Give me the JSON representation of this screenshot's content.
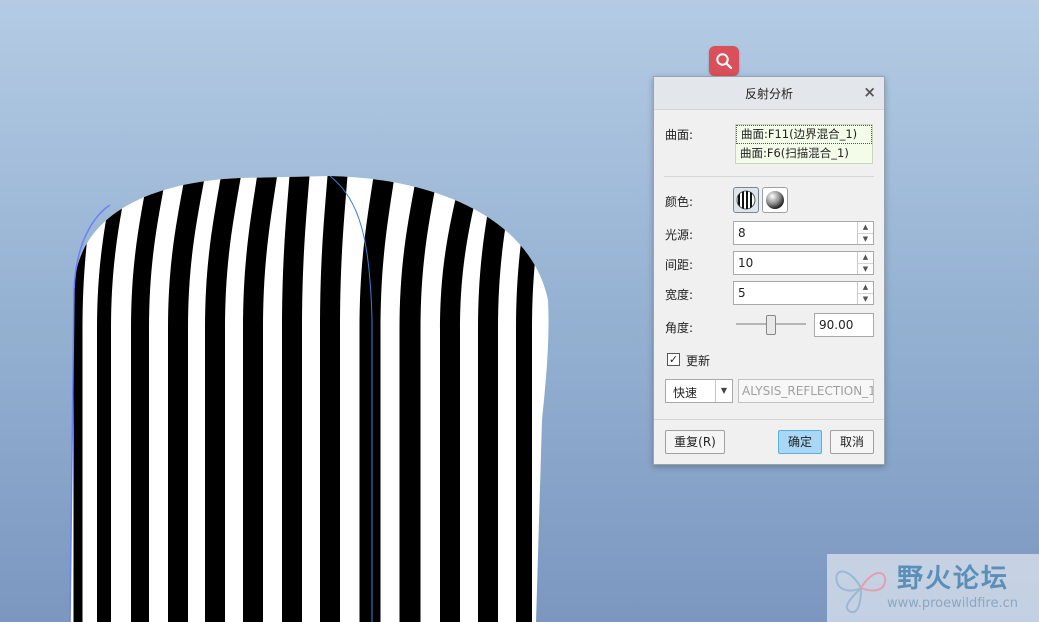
{
  "dialog": {
    "title": "反射分析",
    "surface_label": "曲面:",
    "surfaces": [
      "曲面:F11(边界混合_1)",
      "曲面:F6(扫描混合_1)"
    ],
    "color_label": "颜色:",
    "light_label": "光源:",
    "light_value": "8",
    "spacing_label": "间距:",
    "spacing_value": "10",
    "width_label": "宽度:",
    "width_value": "5",
    "angle_label": "角度:",
    "angle_value": "90.00",
    "update_label": "更新",
    "update_checked": "✓",
    "mode_value": "快速",
    "analysis_name": "ALYSIS_REFLECTION_1",
    "repeat_label": "重复(R)",
    "ok_label": "确定",
    "cancel_label": "取消"
  },
  "icons": {
    "search": "magnifier-icon",
    "close": "close-icon",
    "stripe_color": "zebra-stripes-icon",
    "shaded_color": "shaded-sphere-icon"
  },
  "watermark": {
    "title": "野火论坛",
    "url": "www.proewildfire.cn"
  },
  "colors": {
    "accent": "#d9505a",
    "primary_button": "#a8d8f5",
    "surface_list_bg": "#f3fbe9"
  }
}
